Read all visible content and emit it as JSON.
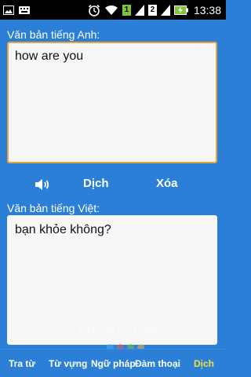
{
  "status_bar": {
    "time": "13:38",
    "sim1": "1",
    "sim2": "2",
    "icons": [
      "image-icon",
      "keyboard-icon",
      "alarm-icon",
      "wifi-icon",
      "signal-icon",
      "battery-charging-icon"
    ]
  },
  "source": {
    "label": "Văn bản tiếng Anh:",
    "value": "how are you"
  },
  "actions": {
    "speak_icon": "speaker-icon",
    "translate_label": "Dịch",
    "clear_label": "Xóa"
  },
  "target": {
    "label": "Văn bản tiếng Việt:",
    "value": "bạn khỏe không?"
  },
  "watermark": {
    "brand": "Download",
    "suffix": ".com.vn"
  },
  "nav": {
    "items": [
      {
        "label": "Tra từ"
      },
      {
        "label": "Từ vựng"
      },
      {
        "label": "Ngữ pháp"
      },
      {
        "label": "Đàm thoại"
      },
      {
        "label": "Dịch"
      }
    ],
    "active_index": 4
  },
  "colors": {
    "background": "#2b7fd6",
    "input_border": "#e8a33d",
    "active_nav": "#f2e23a"
  }
}
